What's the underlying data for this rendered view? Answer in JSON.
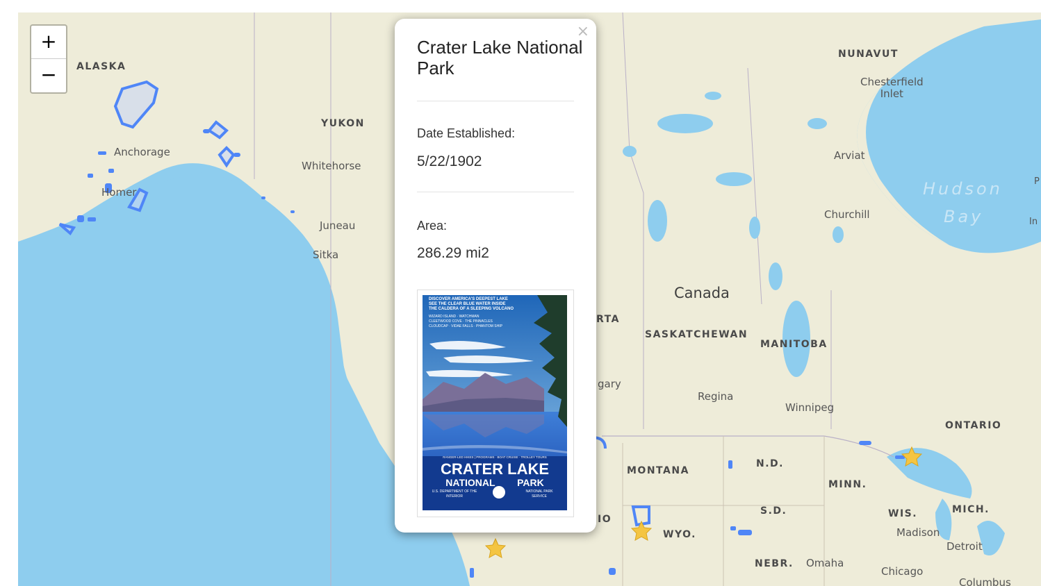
{
  "map": {
    "zoom_in_label": "+",
    "zoom_out_label": "−",
    "labels": {
      "alaska": "ALASKA",
      "yukon": "YUKON",
      "nunavut": "NUNAVUT",
      "chesterfield": "Chesterfield\nInlet",
      "anchorage": "Anchorage",
      "whitehorse": "Whitehorse",
      "homer": "Homer",
      "juneau": "Juneau",
      "sitka": "Sitka",
      "arviat": "Arviat",
      "hudson": "Hudson",
      "bay": "Bay",
      "churchill": "Churchill",
      "canada": "Canada",
      "alberta_partial": "RTA",
      "saskatchewan": "SASKATCHEWAN",
      "manitoba": "MANITOBA",
      "calgary_partial": "gary",
      "regina": "Regina",
      "winnipeg": "Winnipeg",
      "ontario": "ONTARIO",
      "montana": "MONTANA",
      "nd": "N.D.",
      "minn": "MINN.",
      "sd": "S.D.",
      "wyo": "WYO.",
      "idaho_partial": "IO",
      "wis": "WIS.",
      "mich": "MICH.",
      "madison": "Madison",
      "detroit": "Detroit",
      "nebr": "NEBR.",
      "omaha": "Omaha",
      "chicago": "Chicago",
      "columbus": "Columbus",
      "edge_p": "P",
      "edge_in": "In"
    },
    "colors": {
      "water": "#8ecdee",
      "land": "#eeecd9",
      "park": "#4f86f7",
      "star": "#f4c542"
    }
  },
  "popup": {
    "title": "Crater Lake National Park",
    "close_label": "×",
    "date_label": "Date Established:",
    "date_value": "5/22/1902",
    "area_label": "Area:",
    "area_value": "286.29 mi2",
    "poster": {
      "header": [
        "DISCOVER AMERICA'S DEEPEST LAKE",
        "SEE THE CLEAR BLUE WATER INSIDE",
        "THE CALDERA OF A SLEEPING VOLCANO"
      ],
      "sub": [
        "WIZARD ISLAND · WATCHMAN",
        "CLEETWOOD COVE · THE PINNACLES",
        "CLOUDCAP · VIDAE FALLS · PHANTOM SHIP"
      ],
      "footer_small": "RANGER-LED HIKES | PROGRAMS · BOAT CRUISE · TROLLEY TOURS",
      "name_line1": "CRATER LAKE",
      "name_line2a": "NATIONAL",
      "name_line2b": "PARK",
      "dept": "U.S. DEPARTMENT OF THE INTERIOR",
      "service": "NATIONAL PARK SERVICE"
    }
  }
}
